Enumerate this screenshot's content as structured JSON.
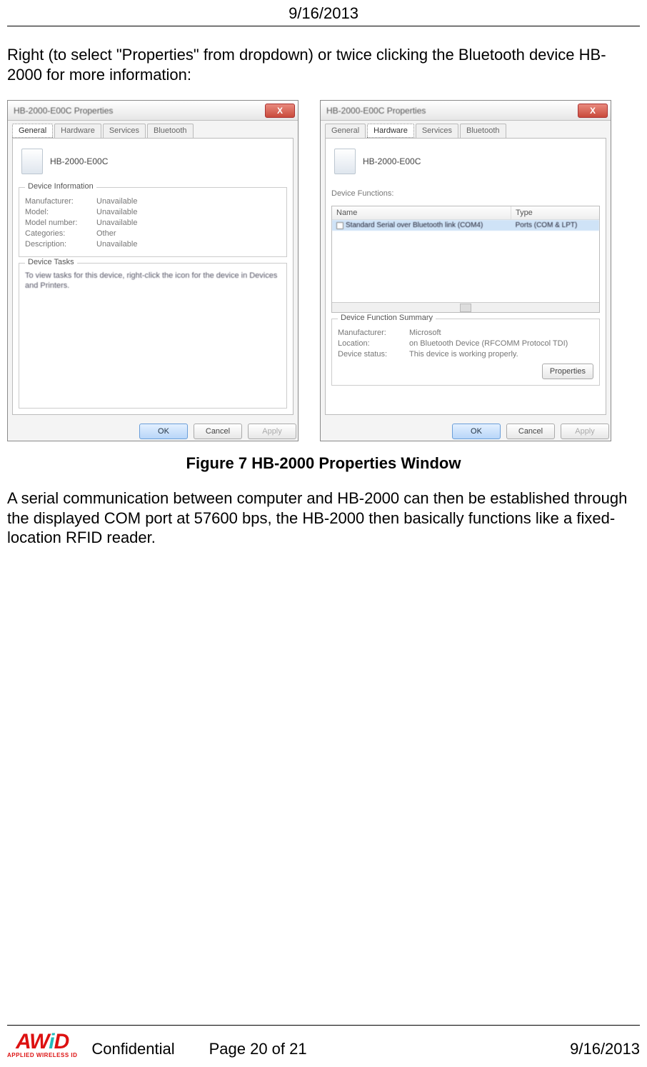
{
  "header": {
    "date": "9/16/2013"
  },
  "paragraph1": "Right (to select \"Properties\" from dropdown) or twice clicking the Bluetooth device HB-2000 for more information:",
  "dialog_left": {
    "title": "HB-2000-E00C Properties",
    "close": "X",
    "tabs": [
      "General",
      "Hardware",
      "Services",
      "Bluetooth"
    ],
    "active_tab": 0,
    "device_name": "HB-2000-E00C",
    "group1_title": "Device Information",
    "info": {
      "manufacturer_k": "Manufacturer:",
      "manufacturer_v": "Unavailable",
      "model_k": "Model:",
      "model_v": "Unavailable",
      "modelnum_k": "Model number:",
      "modelnum_v": "Unavailable",
      "categories_k": "Categories:",
      "categories_v": "Other",
      "description_k": "Description:",
      "description_v": "Unavailable"
    },
    "group2_title": "Device Tasks",
    "tasks_text": "To view tasks for this device, right-click the icon for the device in Devices and Printers.",
    "buttons": {
      "ok": "OK",
      "cancel": "Cancel",
      "apply": "Apply"
    }
  },
  "dialog_right": {
    "title": "HB-2000-E00C Properties",
    "close": "X",
    "tabs": [
      "General",
      "Hardware",
      "Services",
      "Bluetooth"
    ],
    "active_tab": 1,
    "device_name": "HB-2000-E00C",
    "functions_label": "Device Functions:",
    "list_headers": {
      "name": "Name",
      "type": "Type"
    },
    "list_row": {
      "name": "Standard Serial over Bluetooth link (COM4)",
      "type": "Ports (COM & LPT)"
    },
    "summary_title": "Device Function Summary",
    "summary": {
      "manufacturer_k": "Manufacturer:",
      "manufacturer_v": "Microsoft",
      "location_k": "Location:",
      "location_v": "on Bluetooth Device (RFCOMM Protocol TDI)",
      "status_k": "Device status:",
      "status_v": "This device is working properly."
    },
    "properties_btn": "Properties",
    "buttons": {
      "ok": "OK",
      "cancel": "Cancel",
      "apply": "Apply"
    }
  },
  "figure_caption": "Figure 7 HB-2000 Properties Window",
  "paragraph2": "A serial communication between computer and HB-2000 can then be established through the displayed COM port at 57600 bps, the HB-2000 then basically functions like a fixed-location RFID reader.",
  "footer": {
    "logo_top": "AWiD",
    "logo_sub": "APPLIED WIRELESS ID",
    "confidential": "Confidential",
    "page": "Page 20 of 21",
    "date": "9/16/2013"
  }
}
